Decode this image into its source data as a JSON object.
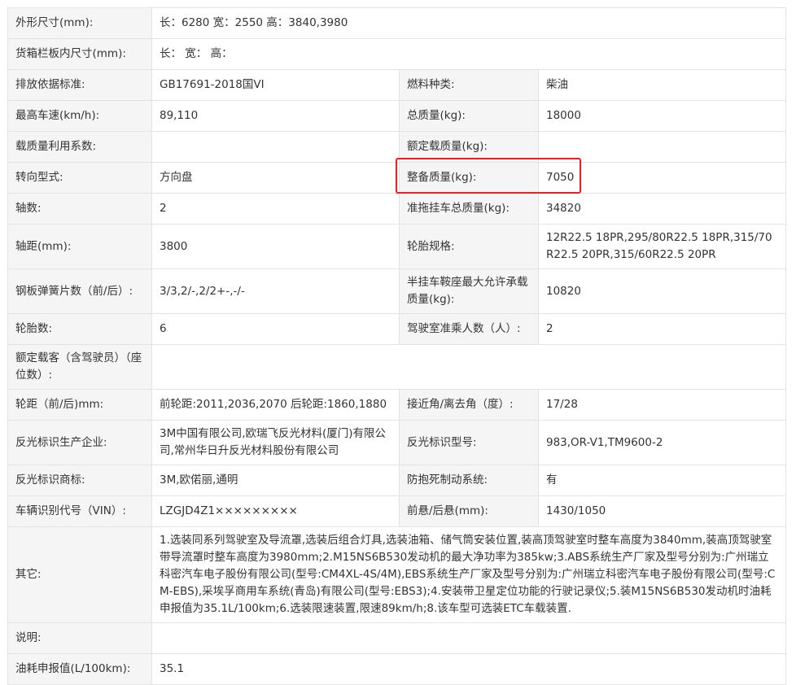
{
  "colors": {
    "label_bg": "#f5f5f5",
    "value_bg": "#ffffff",
    "border": "#e3e3e3",
    "highlight": "#e8202a"
  },
  "rows": {
    "r1": {
      "label": "外形尺寸(mm):",
      "value": "长：6280 宽：2550 高：3840,3980"
    },
    "r2": {
      "label": "货箱栏板内尺寸(mm):",
      "value": "长： 宽： 高："
    },
    "r3": {
      "label_a": "排放依据标准:",
      "value_a": "GB17691-2018国VI",
      "label_b": "燃料种类:",
      "value_b": "柴油"
    },
    "r4": {
      "label_a": "最高车速(km/h):",
      "value_a": "89,110",
      "label_b": "总质量(kg):",
      "value_b": "18000"
    },
    "r5": {
      "label_a": "载质量利用系数:",
      "value_a": "",
      "label_b": "额定载质量(kg):",
      "value_b": ""
    },
    "r6": {
      "label_a": "转向型式:",
      "value_a": "方向盘",
      "label_b": "整备质量(kg):",
      "value_b": "7050"
    },
    "r7": {
      "label_a": "轴数:",
      "value_a": "2",
      "label_b": "准拖挂车总质量(kg):",
      "value_b": "34820"
    },
    "r8": {
      "label_a": "轴距(mm):",
      "value_a": "3800",
      "label_b": "轮胎规格:",
      "value_b": "12R22.5 18PR,295/80R22.5 18PR,315/70R22.5 20PR,315/60R22.5 20PR"
    },
    "r9": {
      "label_a": "钢板弹簧片数（前/后）:",
      "value_a": "3/3,2/-,2/2+-,-/-",
      "label_b": "半挂车鞍座最大允许承载质量(kg):",
      "value_b": "10820"
    },
    "r10": {
      "label_a": "轮胎数:",
      "value_a": "6",
      "label_b": "驾驶室准乘人数（人）:",
      "value_b": "2"
    },
    "r11": {
      "label": "额定载客（含驾驶员）（座位数）:",
      "value": ""
    },
    "r12": {
      "label_a": "轮距（前/后)mm:",
      "value_a": "前轮距:2011,2036,2070 后轮距:1860,1880",
      "label_b": "接近角/离去角（度）:",
      "value_b": "17/28"
    },
    "r13": {
      "label_a": "反光标识生产企业:",
      "value_a": "3M中国有限公司,欧瑞飞反光材料(厦门)有限公司,常州华日升反光材料股份有限公司",
      "label_b": "反光标识型号:",
      "value_b": "983,OR-V1,TM9600-2"
    },
    "r14": {
      "label_a": "反光标识商标:",
      "value_a": "3M,欧偌丽,通明",
      "label_b": "防抱死制动系统:",
      "value_b": "有"
    },
    "r15": {
      "label_a": "车辆识别代号（VIN）:",
      "value_a": "LZGJD4Z1×××××××××",
      "label_b": "前悬/后悬(mm):",
      "value_b": "1430/1050"
    },
    "r16": {
      "label": "其它:",
      "value": "1.选装同系列驾驶室及导流罩,选装后组合灯具,选装油箱、储气筒安装位置,装高顶驾驶室时整车高度为3840mm,装高顶驾驶室带导流罩时整车高度为3980mm;2.M15NS6B530发动机的最大净功率为385kw;3.ABS系统生产厂家及型号分别为:广州瑞立科密汽车电子股份有限公司(型号:CM4XL-4S/4M),EBS系统生产厂家及型号分别为:广州瑞立科密汽车电子股份有限公司(型号:CM-EBS),采埃孚商用车系统(青岛)有限公司(型号:EBS3);4.安装带卫星定位功能的行驶记录仪;5.装M15NS6B530发动机时油耗申报值为35.1L/100km;6.选装限速装置,限速89km/h;8.该车型可选装ETC车载装置."
    },
    "r17": {
      "label": "说明:",
      "value": ""
    },
    "r18": {
      "label": "油耗申报值(L/100km):",
      "value": "35.1"
    }
  }
}
